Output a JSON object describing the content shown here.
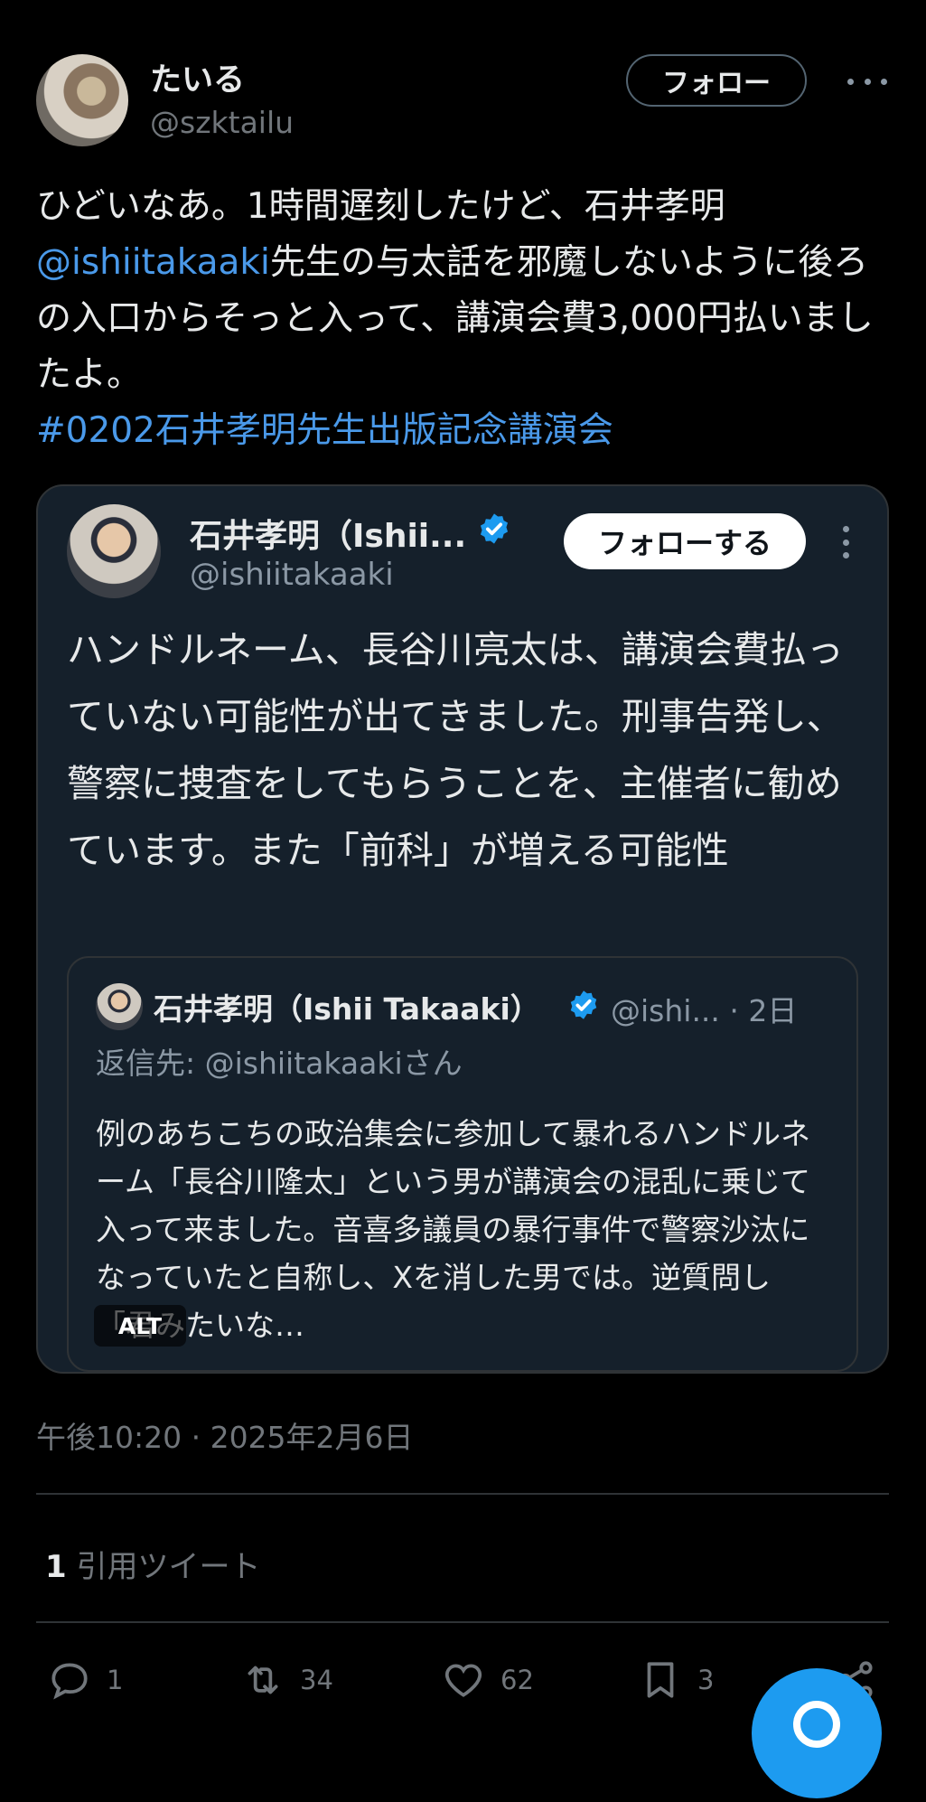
{
  "author": {
    "name": "たいる",
    "handle": "@szktailu",
    "follow_label": "フォロー"
  },
  "tweet": {
    "text_part1": "ひどいなあ。1時間遅刻したけど、石井孝明",
    "mention": "@ishiitakaaki",
    "text_part2": "先生の与太話を邪魔しないように後ろの入口からそっと入って、講演会費3,000円払いましたよ。",
    "hashtag": "#0202石井孝明先生出版記念講演会",
    "timestamp": "午後10:20 · 2025年2月6日"
  },
  "quoted": {
    "name": "石井孝明（Ishii...",
    "handle": "@ishiitakaaki",
    "follow_label": "フォローする",
    "text": "ハンドルネーム、長谷川亮太は、講演会費払っていない可能性が出てきました。刑事告発し、警察に捜査をしてもらうことを、主催者に勧めています。また「前科」が増える可能性",
    "inner": {
      "name": "石井孝明（Ishii Takaaki）",
      "handle": "@ishi... · 2日",
      "reply_to": "返信先: @ishiitakaakiさん",
      "text": "例のあちこちの政治集会に参加して暴れるハンドルネーム「長谷川隆太」という男が講演会の混乱に乗じて入って来ました。音喜多議員の暴行事件で警察沙汰になっていたと自称し、Xを消した男では。逆質問し「君みたいな…",
      "alt_badge": "ALT"
    }
  },
  "stats": {
    "quote_count": "1",
    "quote_label": "引用ツイート"
  },
  "actions": {
    "reply_count": "1",
    "retweet_count": "34",
    "like_count": "62",
    "bookmark_count": "3"
  },
  "colors": {
    "accent": "#1d9bf0",
    "link": "#4a99e9",
    "background": "#000000"
  }
}
